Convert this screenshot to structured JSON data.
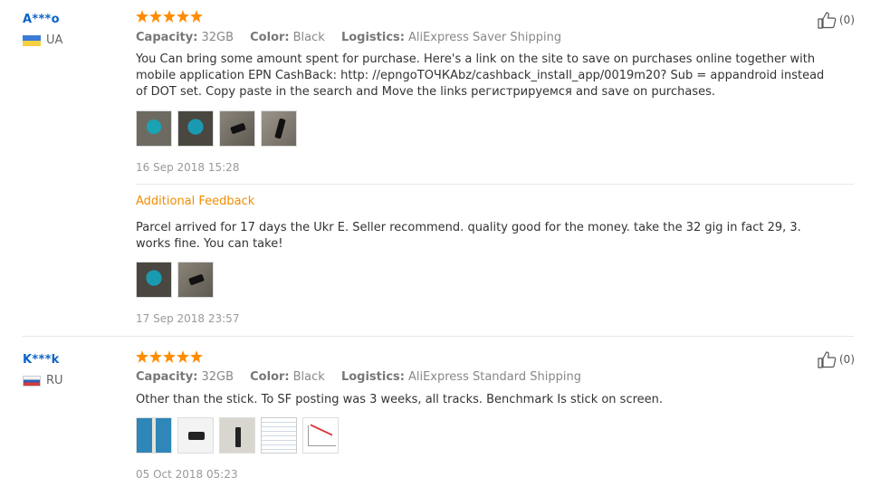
{
  "reviews": [
    {
      "user": "A***o",
      "country": "UA",
      "rating": 5,
      "capacity_label": "Capacity:",
      "capacity": "32GB",
      "color_label": "Color:",
      "color": "Black",
      "logistics_label": "Logistics:",
      "logistics": "AliExpress Saver Shipping",
      "text": "You Can bring some amount spent for purchase. Here's a link on the site to save on purchases online together with mobile application EPN CashBack: http: //epngoТОЧКAbz/cashback_install_app/0019m20? Sub = appandroid instead of DOT set. Copy paste in the search and Move the links регистрируемся and save on purchases.",
      "date": "16 Sep 2018 15:28",
      "helpful": "(0)",
      "additional": {
        "title": "Additional Feedback",
        "text": "Parcel arrived for 17 days the Ukr E. Seller recommend. quality good for the money. take the 32 gig in fact 29, 3. works fine. You can take!",
        "date": "17 Sep 2018 23:57"
      }
    },
    {
      "user": "K***k",
      "country": "RU",
      "rating": 5,
      "capacity_label": "Capacity:",
      "capacity": "32GB",
      "color_label": "Color:",
      "color": "Black",
      "logistics_label": "Logistics:",
      "logistics": "AliExpress Standard Shipping",
      "text": "Other than the stick. To SF posting was 3 weeks, all tracks. Benchmark Is stick on screen.",
      "date": "05 Oct 2018 05:23",
      "helpful": "(0)"
    }
  ],
  "colors": {
    "user": "#0a64c7",
    "star": "#ff8c00",
    "additional": "#f28c00"
  }
}
